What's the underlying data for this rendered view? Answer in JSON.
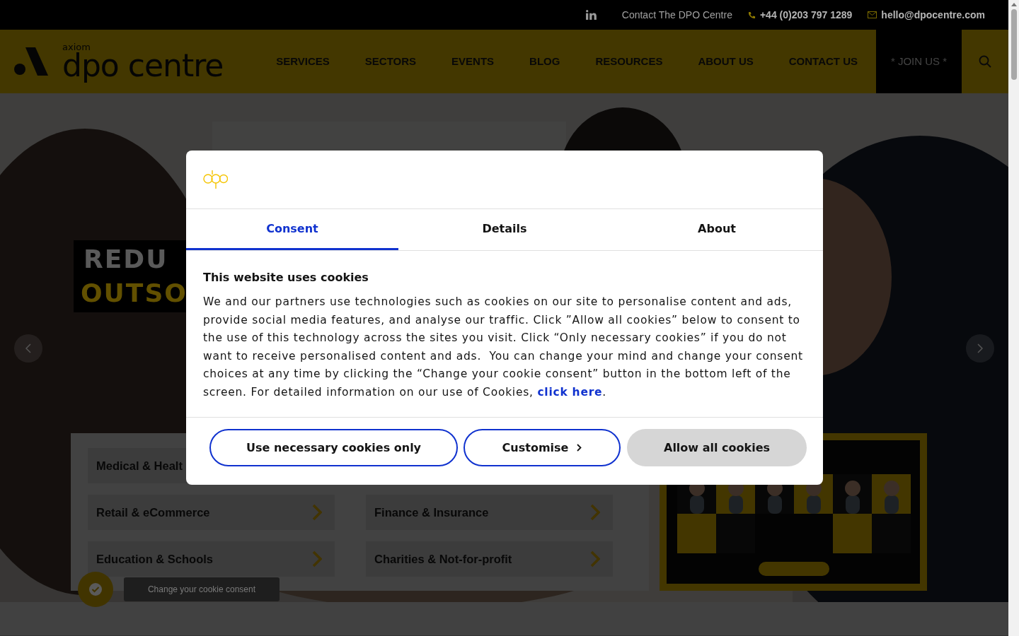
{
  "top_bar": {
    "contact_link": "Contact The DPO Centre",
    "phone": "+44 (0)203 797 1289",
    "email": "hello@dpocentre.com"
  },
  "nav": {
    "logo_small": "axiom",
    "logo_main": "dpo centre",
    "items": [
      "SERVICES",
      "SECTORS",
      "EVENTS",
      "BLOG",
      "RESOURCES",
      "ABOUT US",
      "CONTACT US"
    ],
    "join": "* JOIN US *"
  },
  "hero": {
    "headline_lines": [
      "REDU",
      "OUTSO"
    ],
    "sector_rows": [
      [
        {
          "label": "Medical & Healt",
          "arrow": false
        }
      ],
      [
        {
          "label": "Retail & eCommerce",
          "arrow": true
        },
        {
          "label": "Finance & Insurance",
          "arrow": true
        }
      ],
      [
        {
          "label": "Education & Schools",
          "arrow": true
        },
        {
          "label": "Charities & Not-for-profit",
          "arrow": true
        }
      ]
    ],
    "promo": {
      "kind": "picture"
    }
  },
  "consent_widget": {
    "label": "Change your cookie consent"
  },
  "cookie_dialog": {
    "tabs": [
      {
        "label": "Consent",
        "selected": true
      },
      {
        "label": "Details",
        "selected": false
      },
      {
        "label": "About",
        "selected": false
      }
    ],
    "title": "This website uses cookies",
    "body": "We and our partners use technologies such as cookies on our site to personalise content and ads, provide social media features, and analyse our traffic. Click ”Allow all cookies” below to consent to the use of this technology across the sites you visit. Click “Only necessary cookies” if you do not want to receive personalised content and ads.  You can change your mind and change your consent choices at any time by clicking the “Change your cookie consent” button in the bottom left of the screen. For detailed information on our use of Cookies, ",
    "link": "click here",
    "body_end": ".",
    "buttons": [
      {
        "label": "Use necessary cookies only",
        "kind": "outline",
        "chevron": false
      },
      {
        "label": "Customise",
        "kind": "outline",
        "chevron": true
      },
      {
        "label": "Allow all cookies",
        "kind": "filled",
        "chevron": false
      }
    ]
  }
}
